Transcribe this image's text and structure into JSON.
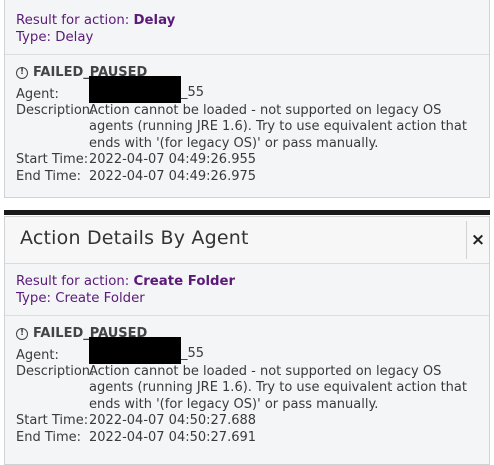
{
  "panel1": {
    "result_label": "Result for action:",
    "action_name": "Delay",
    "type_label": "Type:",
    "type_value": "Delay",
    "status": "FAILED_PAUSED",
    "agent_label": "Agent:",
    "agent_suffix": "_55",
    "description_label": "Description:",
    "description": "Action cannot be loaded - not supported on legacy OS agents (running JRE 1.6). Try to use equivalent action that ends with '(for legacy OS)' or pass manually.",
    "start_label": "Start Time:",
    "start_time": "2022-04-07 04:49:26.955",
    "end_label": "End Time:",
    "end_time": "2022-04-07 04:49:26.975"
  },
  "panel2": {
    "title": "Action Details By Agent",
    "close_icon": "×",
    "result_label": "Result for action:",
    "action_name": "Create Folder",
    "type_label": "Type:",
    "type_value": "Create Folder",
    "status": "FAILED_PAUSED",
    "agent_label": "Agent:",
    "agent_suffix": "_55",
    "description_label": "Description:",
    "description": "Action cannot be loaded - not supported on legacy OS agents (running JRE 1.6). Try to use equivalent action that ends with '(for legacy OS)' or pass manually.",
    "start_label": "Start Time:",
    "start_time": "2022-04-07 04:50:27.688",
    "end_label": "End Time:",
    "end_time": "2022-04-07 04:50:27.691"
  },
  "colors": {
    "accent_purple": "#5b1a78",
    "panel_bg": "#f3f5f7",
    "redaction": "#000000"
  }
}
